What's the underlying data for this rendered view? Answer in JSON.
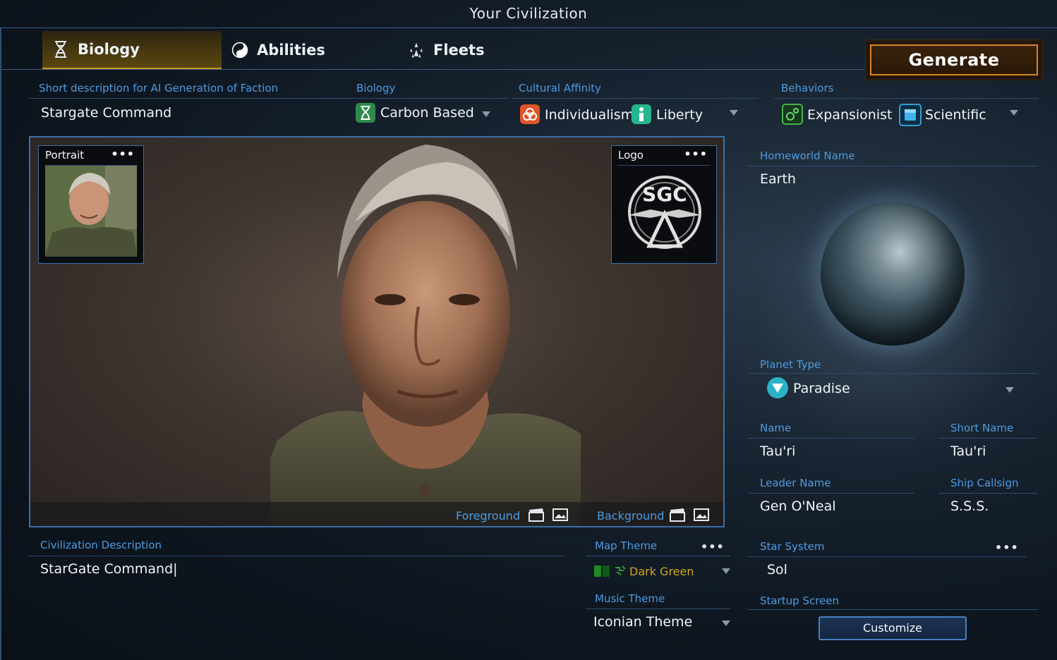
{
  "window": {
    "title": "Your Civilization"
  },
  "tabs": [
    {
      "label": "Biology",
      "icon": "dna-icon",
      "active": true
    },
    {
      "label": "Abilities",
      "icon": "yin-yang-icon",
      "active": false
    },
    {
      "label": "Fleets",
      "icon": "fleet-icon",
      "active": false
    }
  ],
  "generate": {
    "label": "Generate"
  },
  "short_description": {
    "label": "Short description for AI Generation of Faction",
    "value": "Stargate Command"
  },
  "biology": {
    "label": "Biology",
    "value": "Carbon Based"
  },
  "cultural_affinity": {
    "label": "Cultural Affinity",
    "values": [
      "Individualism",
      "Liberty"
    ]
  },
  "behaviors": {
    "label": "Behaviors",
    "values": [
      "Expansionist",
      "Scientific"
    ]
  },
  "portrait": {
    "caption": "Portrait",
    "menu": "•••"
  },
  "logo": {
    "caption": "Logo",
    "menu": "•••",
    "text": "SGC"
  },
  "image_footer": {
    "foreground": "Foreground",
    "background": "Background"
  },
  "homeworld": {
    "label": "Homeworld Name",
    "value": "Earth"
  },
  "planet_type": {
    "label": "Planet Type",
    "value": "Paradise"
  },
  "name": {
    "label": "Name",
    "value": "Tau'ri"
  },
  "short_name": {
    "label": "Short Name",
    "value": "Tau'ri"
  },
  "leader_name": {
    "label": "Leader Name",
    "value": "Gen O'Neal"
  },
  "ship_callsign": {
    "label": "Ship Callsign",
    "value": "S.S.S."
  },
  "civ_description": {
    "label": "Civilization Description",
    "value": "StarGate Command|"
  },
  "map_theme": {
    "label": "Map Theme",
    "value": "Dark Green",
    "menu": "•••"
  },
  "music_theme": {
    "label": "Music Theme",
    "value": "Iconian Theme"
  },
  "star_system": {
    "label": "Star System",
    "value": "Sol",
    "menu": "•••"
  },
  "startup_screen": {
    "label": "Startup Screen",
    "button": "Customize"
  },
  "colors": {
    "accent_blue": "#4e9be0",
    "generate_border": "#d88424",
    "active_tab": "#c9971f",
    "map_theme_text": "#d4a521"
  }
}
